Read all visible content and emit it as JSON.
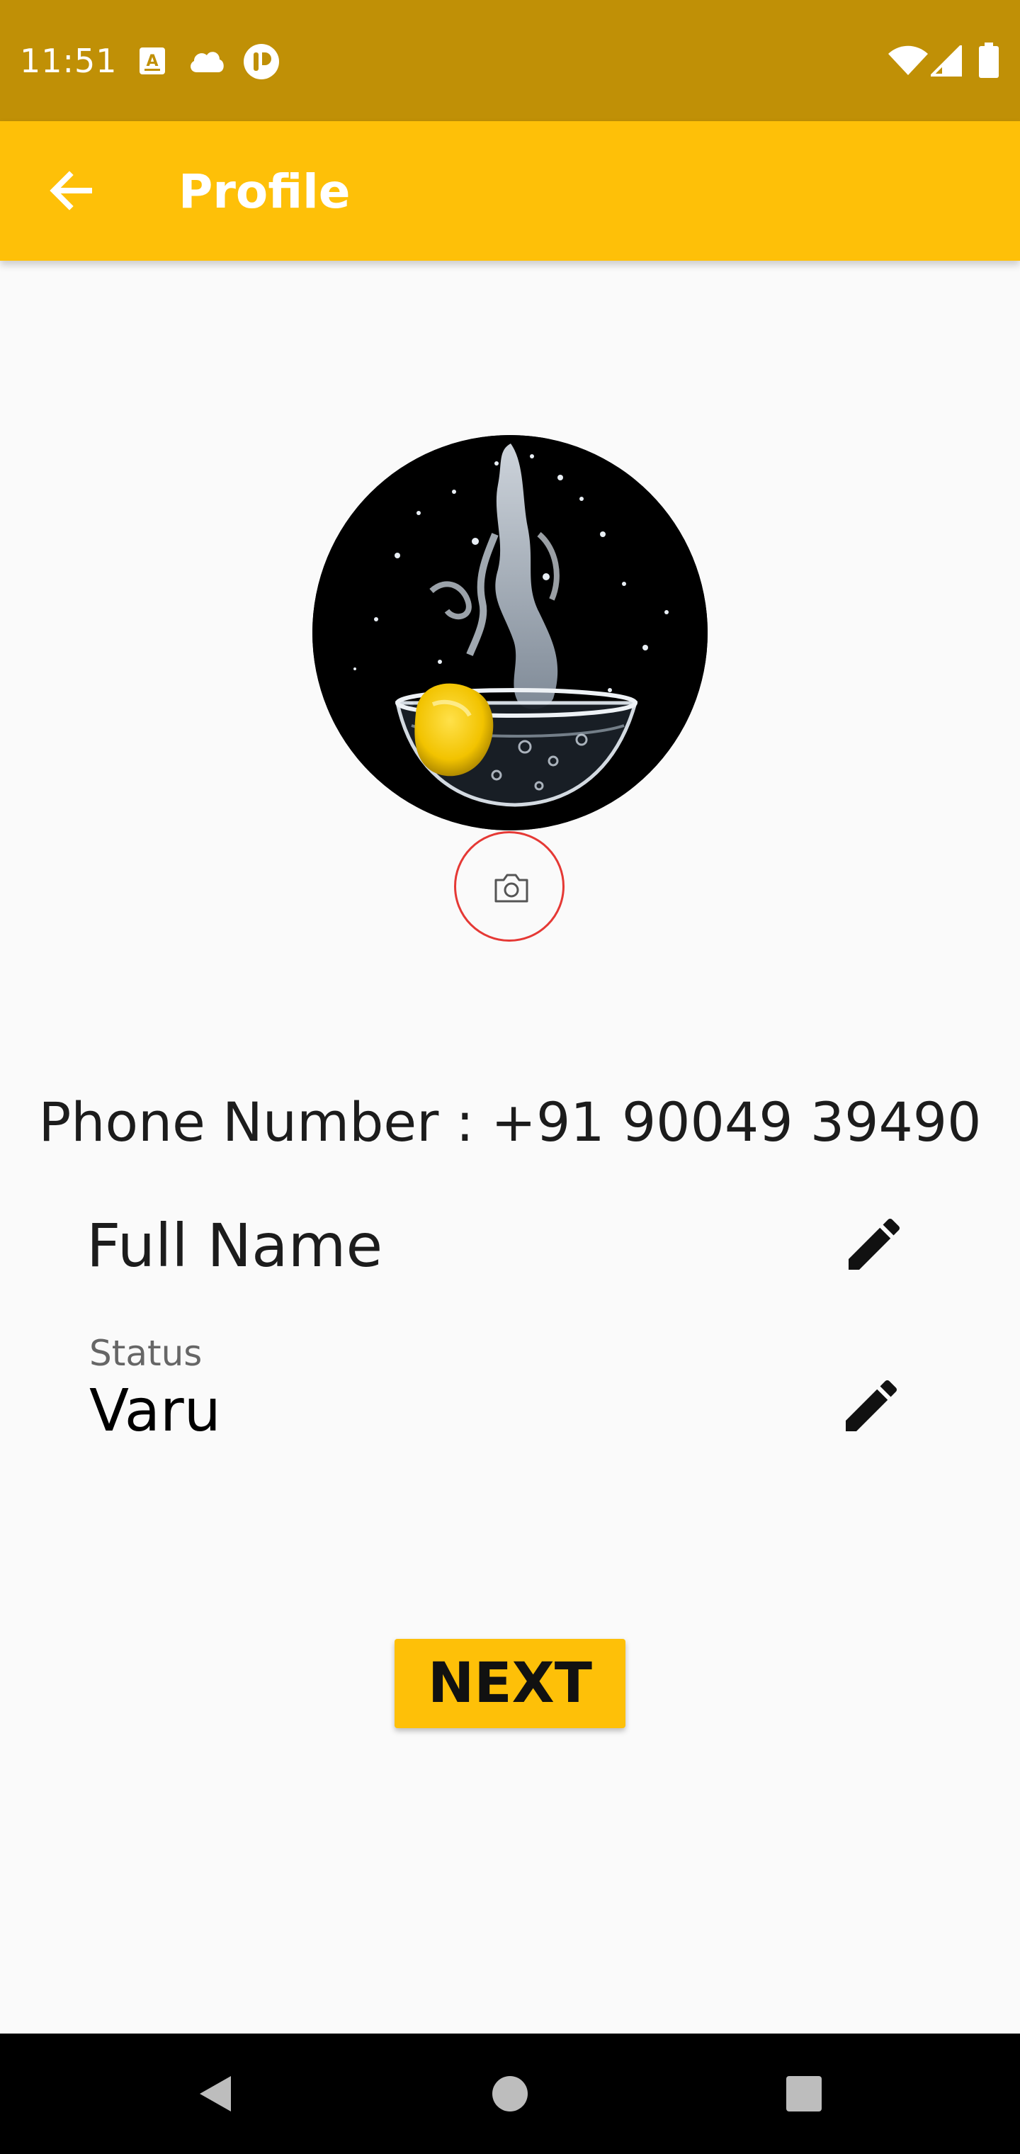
{
  "status_bar": {
    "time": "11:51",
    "icons": [
      "text-badge-icon",
      "cloud-icon",
      "app-notification-icon",
      "wifi-icon",
      "signal-icon",
      "battery-icon"
    ]
  },
  "app_bar": {
    "title": "Profile",
    "back_icon": "arrow-left-icon"
  },
  "profile": {
    "photo_description_icon": "profile-photo",
    "camera_icon": "camera-icon",
    "phone_number": "Phone Number : +91 90049 39490",
    "full_name": "Full Name",
    "status_label": "Status",
    "status_value": "Varu",
    "edit_icon": "pencil-icon"
  },
  "actions": {
    "next_label": "NEXT"
  },
  "nav_bar": {
    "icons": [
      "back-triangle-icon",
      "home-circle-icon",
      "recents-square-icon"
    ]
  },
  "colors": {
    "status_bar": "#c09006",
    "app_bar": "#fec008",
    "accent": "#fec008",
    "camera_ring": "#e53935",
    "background": "#fafafa"
  }
}
